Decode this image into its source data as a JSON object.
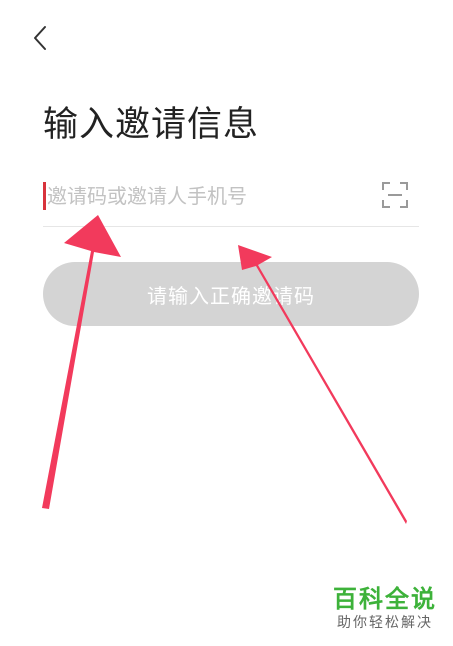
{
  "header": {
    "back_icon": "chevron-left-icon",
    "title": "输入邀请信息"
  },
  "invite_form": {
    "placeholder": "邀请码或邀请人手机号",
    "value": "",
    "scan_icon": "scan-frame-icon",
    "submit_label": "请输入正确邀请码"
  },
  "watermark": {
    "title": "百科全说",
    "subtitle": "助你轻松解决"
  },
  "colors": {
    "title_text": "#222222",
    "placeholder_text": "#c2c2c2",
    "cursor": "#d8333c",
    "disabled_button": "#d4d4d4",
    "annotation_arrow": "#f23a5c",
    "watermark_green": "#3db23a"
  }
}
